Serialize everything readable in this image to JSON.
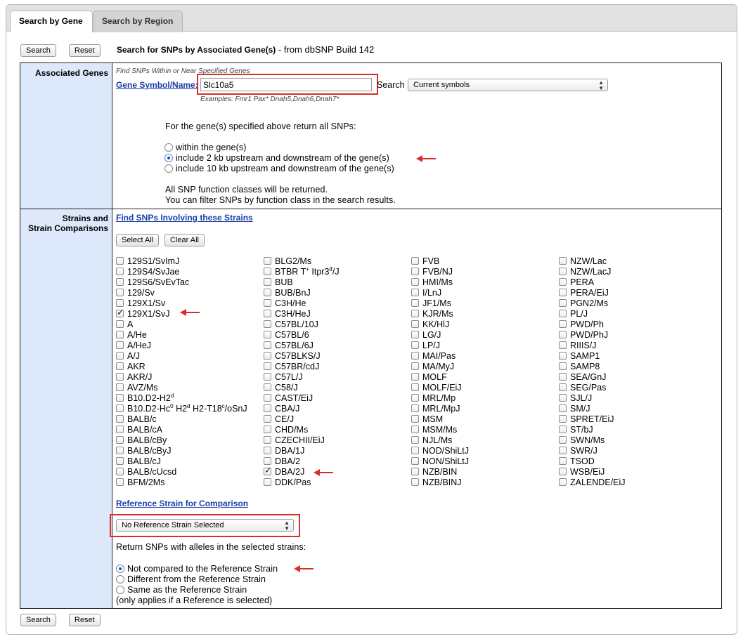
{
  "tabs": [
    {
      "label": "Search by Gene",
      "active": true
    },
    {
      "label": "Search by Region",
      "active": false
    }
  ],
  "toolbar": {
    "search_label": "Search",
    "reset_label": "Reset",
    "title": "Search for SNPs by Associated Gene(s)",
    "subtitle": " - from dbSNP Build 142"
  },
  "associated_genes": {
    "label": "Associated Genes",
    "note": "Find SNPs Within or Near Specified Genes",
    "gene_link": "Gene Symbol/Name:",
    "gene_value": "Slc10a5",
    "search_word": "Search",
    "search_select": "Current symbols",
    "examples": "Examples:    Fmr1    Pax*    Dnah5,Dnah6,Dnah7*",
    "return_text": "For the gene(s) specified above return all SNPs:",
    "options": [
      {
        "label": "within the gene(s)",
        "selected": false
      },
      {
        "label": "include 2 kb upstream and downstream of the gene(s)",
        "selected": true
      },
      {
        "label": "include 10 kb upstream and downstream of the gene(s)",
        "selected": false
      }
    ],
    "info_line1": "All SNP function classes will be returned.",
    "info_line2": "You can filter SNPs by function class in the search results."
  },
  "strains": {
    "label_line1": "Strains and",
    "label_line2": "Strain Comparisons",
    "find_link": "Find SNPs Involving these Strains",
    "select_all": "Select All",
    "clear_all": "Clear All",
    "columns": [
      [
        {
          "name": "129S1/SvImJ",
          "checked": false
        },
        {
          "name": "129S4/SvJae",
          "checked": false
        },
        {
          "name": "129S6/SvEvTac",
          "checked": false
        },
        {
          "name": "129/Sv",
          "checked": false
        },
        {
          "name": "129X1/Sv",
          "checked": false
        },
        {
          "name": "129X1/SvJ",
          "checked": true
        },
        {
          "name": "A",
          "checked": false
        },
        {
          "name": "A/He",
          "checked": false
        },
        {
          "name": "A/HeJ",
          "checked": false
        },
        {
          "name": "A/J",
          "checked": false
        },
        {
          "name": "AKR",
          "checked": false
        },
        {
          "name": "AKR/J",
          "checked": false
        },
        {
          "name": "AVZ/Ms",
          "checked": false
        },
        {
          "name": "B10.D2-H2",
          "sup": "d",
          "checked": false
        },
        {
          "name": "B10.D2-Hc",
          "sup": "0",
          "after": " H2",
          "sup2": "d",
          "after2": " H2-T18",
          "sup3": "c",
          "after3": "/oSnJ",
          "checked": false
        },
        {
          "name": "BALB/c",
          "checked": false
        },
        {
          "name": "BALB/cA",
          "checked": false
        },
        {
          "name": "BALB/cBy",
          "checked": false
        },
        {
          "name": "BALB/cByJ",
          "checked": false
        },
        {
          "name": "BALB/cJ",
          "checked": false
        },
        {
          "name": "BALB/cUcsd",
          "checked": false
        },
        {
          "name": "BFM/2Ms",
          "checked": false
        }
      ],
      [
        {
          "name": "BLG2/Ms",
          "checked": false
        },
        {
          "name": "BTBR T",
          "sup": "+",
          "after": " Itpr3",
          "sup2": "tf",
          "after2": "/J",
          "checked": false
        },
        {
          "name": "BUB",
          "checked": false
        },
        {
          "name": "BUB/BnJ",
          "checked": false
        },
        {
          "name": "C3H/He",
          "checked": false
        },
        {
          "name": "C3H/HeJ",
          "checked": false
        },
        {
          "name": "C57BL/10J",
          "checked": false
        },
        {
          "name": "C57BL/6",
          "checked": false
        },
        {
          "name": "C57BL/6J",
          "checked": false
        },
        {
          "name": "C57BLKS/J",
          "checked": false
        },
        {
          "name": "C57BR/cdJ",
          "checked": false
        },
        {
          "name": "C57L/J",
          "checked": false
        },
        {
          "name": "C58/J",
          "checked": false
        },
        {
          "name": "CAST/EiJ",
          "checked": false
        },
        {
          "name": "CBA/J",
          "checked": false
        },
        {
          "name": "CE/J",
          "checked": false
        },
        {
          "name": "CHD/Ms",
          "checked": false
        },
        {
          "name": "CZECHII/EiJ",
          "checked": false
        },
        {
          "name": "DBA/1J",
          "checked": false
        },
        {
          "name": "DBA/2",
          "checked": false
        },
        {
          "name": "DBA/2J",
          "checked": true
        },
        {
          "name": "DDK/Pas",
          "checked": false
        }
      ],
      [
        {
          "name": "FVB",
          "checked": false
        },
        {
          "name": "FVB/NJ",
          "checked": false
        },
        {
          "name": "HMI/Ms",
          "checked": false
        },
        {
          "name": "I/LnJ",
          "checked": false
        },
        {
          "name": "JF1/Ms",
          "checked": false
        },
        {
          "name": "KJR/Ms",
          "checked": false
        },
        {
          "name": "KK/HlJ",
          "checked": false
        },
        {
          "name": "LG/J",
          "checked": false
        },
        {
          "name": "LP/J",
          "checked": false
        },
        {
          "name": "MAI/Pas",
          "checked": false
        },
        {
          "name": "MA/MyJ",
          "checked": false
        },
        {
          "name": "MOLF",
          "checked": false
        },
        {
          "name": "MOLF/EiJ",
          "checked": false
        },
        {
          "name": "MRL/Mp",
          "checked": false
        },
        {
          "name": "MRL/MpJ",
          "checked": false
        },
        {
          "name": "MSM",
          "checked": false
        },
        {
          "name": "MSM/Ms",
          "checked": false
        },
        {
          "name": "NJL/Ms",
          "checked": false
        },
        {
          "name": "NOD/ShiLtJ",
          "checked": false
        },
        {
          "name": "NON/ShiLtJ",
          "checked": false
        },
        {
          "name": "NZB/BIN",
          "checked": false
        },
        {
          "name": "NZB/BINJ",
          "checked": false
        }
      ],
      [
        {
          "name": "NZW/Lac",
          "checked": false
        },
        {
          "name": "NZW/LacJ",
          "checked": false
        },
        {
          "name": "PERA",
          "checked": false
        },
        {
          "name": "PERA/EiJ",
          "checked": false
        },
        {
          "name": "PGN2/Ms",
          "checked": false
        },
        {
          "name": "PL/J",
          "checked": false
        },
        {
          "name": "PWD/Ph",
          "checked": false
        },
        {
          "name": "PWD/PhJ",
          "checked": false
        },
        {
          "name": "RIIIS/J",
          "checked": false
        },
        {
          "name": "SAMP1",
          "checked": false
        },
        {
          "name": "SAMP8",
          "checked": false
        },
        {
          "name": "SEA/GnJ",
          "checked": false
        },
        {
          "name": "SEG/Pas",
          "checked": false
        },
        {
          "name": "SJL/J",
          "checked": false
        },
        {
          "name": "SM/J",
          "checked": false
        },
        {
          "name": "SPRET/EiJ",
          "checked": false
        },
        {
          "name": "ST/bJ",
          "checked": false
        },
        {
          "name": "SWN/Ms",
          "checked": false
        },
        {
          "name": "SWR/J",
          "checked": false
        },
        {
          "name": "TSOD",
          "checked": false
        },
        {
          "name": "WSB/EiJ",
          "checked": false
        },
        {
          "name": "ZALENDE/EiJ",
          "checked": false
        }
      ]
    ],
    "reference_link": "Reference Strain for Comparison",
    "reference_select": "No Reference Strain Selected",
    "return_alleles": "Return SNPs with alleles in the selected strains:",
    "compare_options": [
      {
        "label": "Not compared to the Reference Strain",
        "selected": true
      },
      {
        "label": "Different from the Reference Strain",
        "selected": false
      },
      {
        "label": "Same as the Reference Strain",
        "selected": false
      }
    ],
    "compare_note": "(only applies if a Reference is selected)"
  },
  "colors": {
    "label_bg": "#dde9fa",
    "link": "#1a3ea8",
    "annotation_red": "#d6302a"
  }
}
